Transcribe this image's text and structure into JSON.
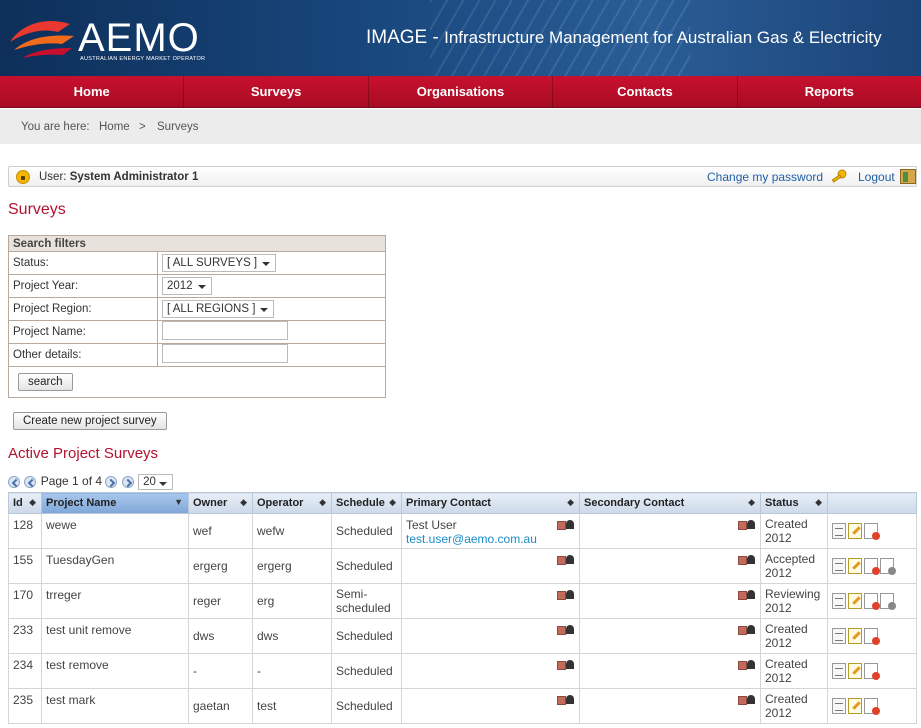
{
  "header": {
    "logo_text": "AEMO",
    "logo_sub": "AUSTRALIAN ENERGY MARKET OPERATOR",
    "app_title_prefix": "IMAGE - ",
    "app_title_rest": "Infrastructure Management for Australian Gas & Electricity"
  },
  "nav": {
    "items": [
      "Home",
      "Surveys",
      "Organisations",
      "Contacts",
      "Reports"
    ]
  },
  "breadcrumb": {
    "prefix": "You are here:",
    "home": "Home",
    "sep": ">",
    "current": "Surveys"
  },
  "userbar": {
    "label": "User:",
    "name": "System Administrator 1",
    "change_password": "Change my password",
    "logout": "Logout"
  },
  "page_title": "Surveys",
  "filters": {
    "heading": "Search filters",
    "status_label": "Status:",
    "status_value": "[ ALL SURVEYS ]",
    "year_label": "Project Year:",
    "year_value": "2012",
    "region_label": "Project Region:",
    "region_value": "[ ALL REGIONS ]",
    "name_label": "Project Name:",
    "other_label": "Other details:",
    "search_button": "search"
  },
  "create_button": "Create new project survey",
  "active_title": "Active Project Surveys",
  "pager": {
    "text": "Page 1 of 4",
    "page_size": "20"
  },
  "columns": {
    "id": "Id",
    "name": "Project Name",
    "owner": "Owner",
    "operator": "Operator",
    "schedule": "Schedule",
    "primary": "Primary Contact",
    "secondary": "Secondary Contact",
    "status": "Status"
  },
  "rows": [
    {
      "id": "128",
      "name": "wewe",
      "owner": "wef",
      "operator": "wefw",
      "schedule": "Scheduled",
      "schedule2": "",
      "primary_name": "Test User",
      "primary_email": "test.user@aemo.com.au",
      "status": "Created",
      "year": "2012"
    },
    {
      "id": "155",
      "name": "TuesdayGen",
      "owner": "ergerg",
      "operator": "ergerg",
      "schedule": "Scheduled",
      "schedule2": "",
      "primary_name": "",
      "primary_email": "",
      "status": "Accepted",
      "year": "2012"
    },
    {
      "id": "170",
      "name": "trreger",
      "owner": "reger",
      "operator": "erg",
      "schedule": "Semi-",
      "schedule2": "scheduled",
      "primary_name": "",
      "primary_email": "",
      "status": "Reviewing",
      "year": "2012"
    },
    {
      "id": "233",
      "name": "test unit remove",
      "owner": "dws",
      "operator": "dws",
      "schedule": "Scheduled",
      "schedule2": "",
      "primary_name": "",
      "primary_email": "",
      "status": "Created",
      "year": "2012"
    },
    {
      "id": "234",
      "name": "test remove",
      "owner": "-",
      "operator": "-",
      "schedule": "Scheduled",
      "schedule2": "",
      "primary_name": "",
      "primary_email": "",
      "status": "Created",
      "year": "2012"
    },
    {
      "id": "235",
      "name": "test mark",
      "owner": "gaetan",
      "operator": "test",
      "schedule": "Scheduled",
      "schedule2": "",
      "primary_name": "",
      "primary_email": "",
      "status": "Created",
      "year": "2012"
    }
  ]
}
